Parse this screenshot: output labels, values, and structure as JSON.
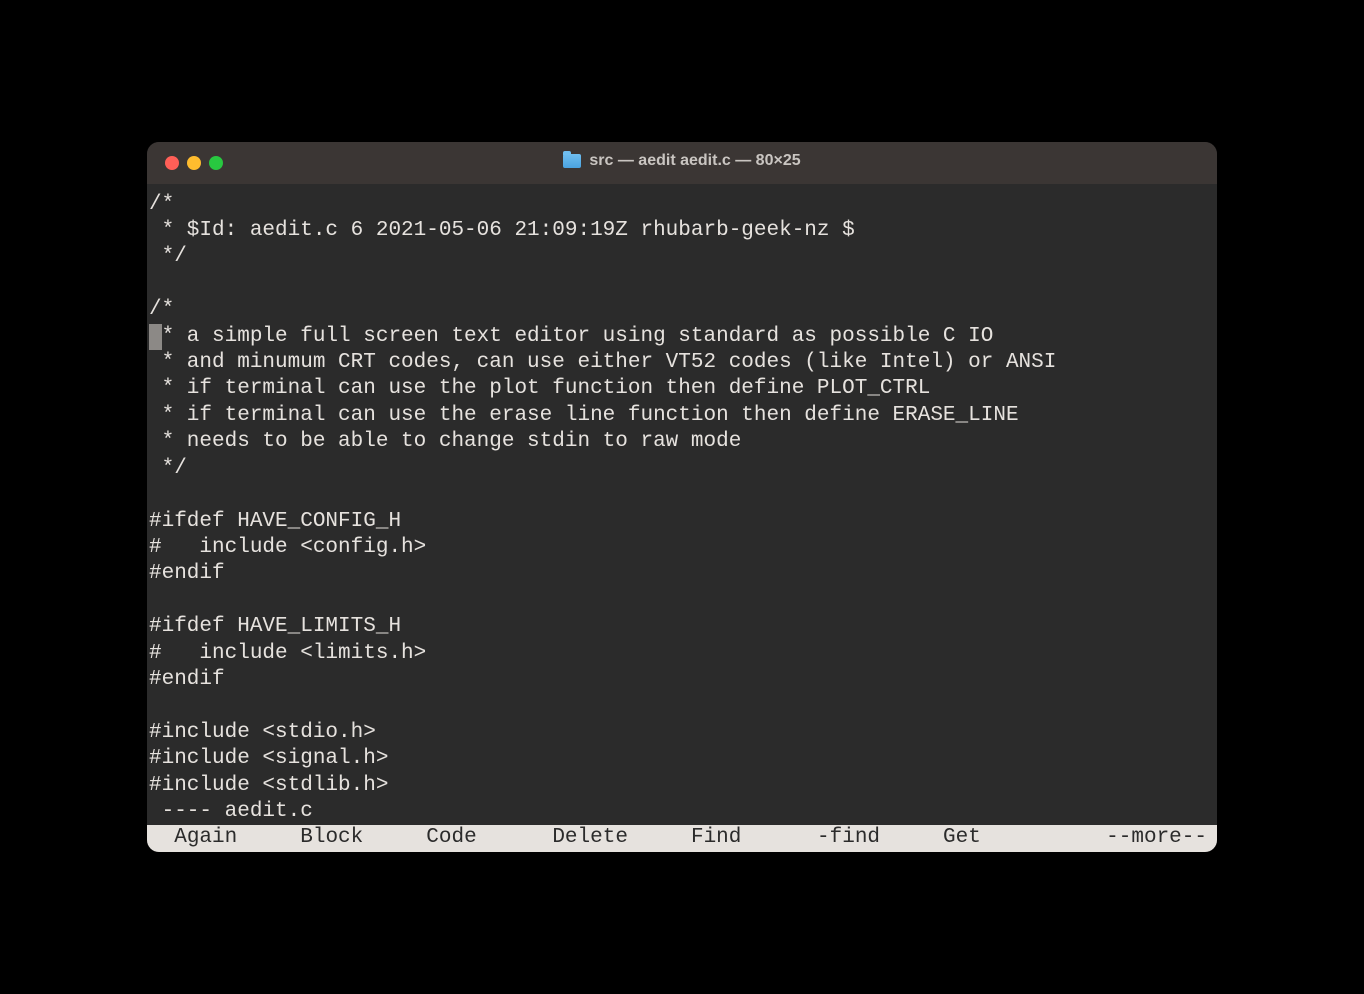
{
  "window": {
    "title": "src — aedit aedit.c — 80×25"
  },
  "editor": {
    "lines": [
      "/*",
      " * $Id: aedit.c 6 2021-05-06 21:09:19Z rhubarb-geek-nz $",
      " */",
      "",
      "/*",
      " * a simple full screen text editor using standard as possible C IO",
      " * and minumum CRT codes, can use either VT52 codes (like Intel) or ANSI",
      " * if terminal can use the plot function then define PLOT_CTRL",
      " * if terminal can use the erase line function then define ERASE_LINE",
      " * needs to be able to change stdin to raw mode",
      " */",
      "",
      "#ifdef HAVE_CONFIG_H",
      "#   include <config.h>",
      "#endif",
      "",
      "#ifdef HAVE_LIMITS_H",
      "#   include <limits.h>",
      "#endif",
      "",
      "#include <stdio.h>",
      "#include <signal.h>",
      "#include <stdlib.h>"
    ],
    "cursor_line_index": 5,
    "status": " ---- aedit.c"
  },
  "menu": {
    "items": [
      "Again",
      "Block",
      "Code",
      "Delete",
      "Find",
      "-find",
      "Get"
    ],
    "more": "--more--"
  }
}
